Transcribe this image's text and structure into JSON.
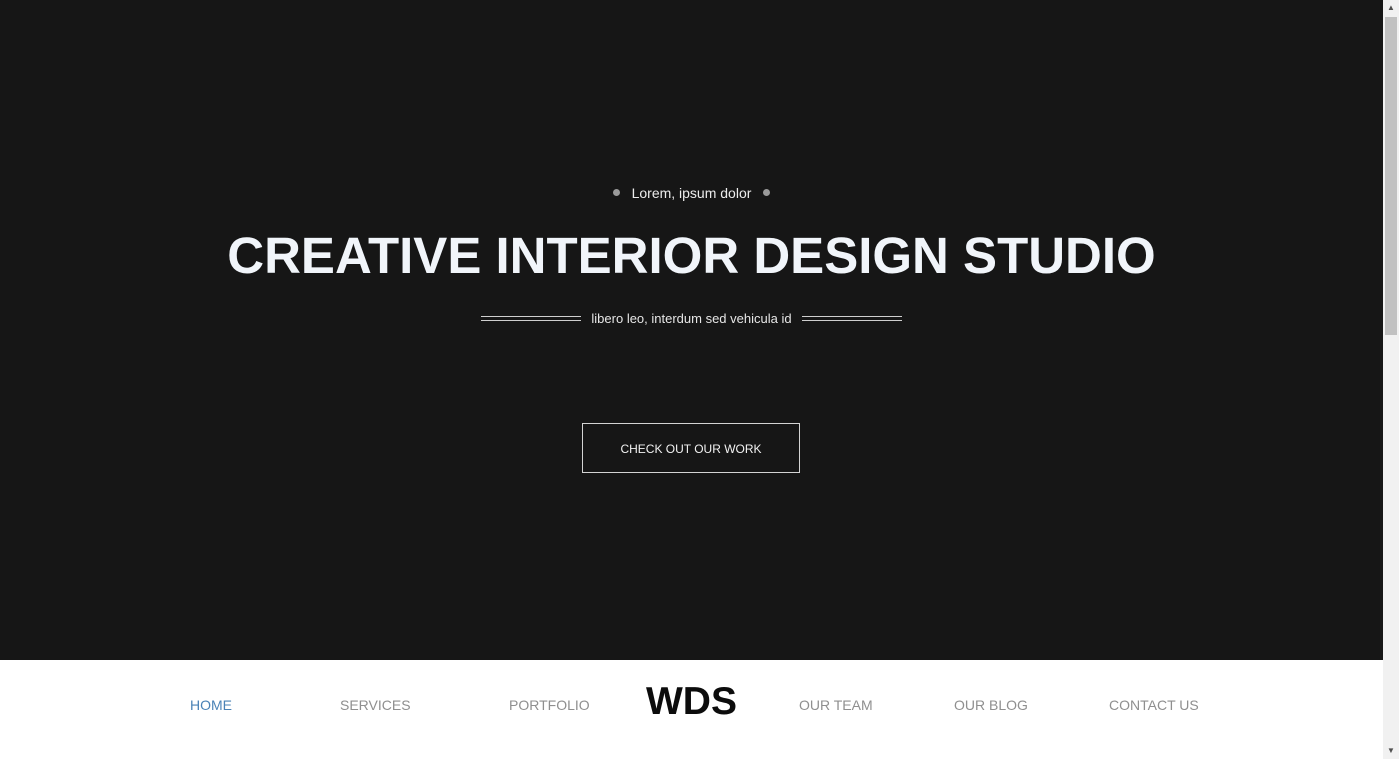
{
  "hero": {
    "eyebrow": "Lorem, ipsum dolor",
    "headline": "CREATIVE INTERIOR DESIGN STUDIO",
    "tagline": "libero leo, interdum sed vehicula id",
    "cta_label": "CHECK OUT OUR WORK",
    "background_color": "#161616"
  },
  "nav": {
    "items": [
      {
        "label": "HOME",
        "active": true
      },
      {
        "label": "SERVICES",
        "active": false
      },
      {
        "label": "PORTFOLIO",
        "active": false
      },
      {
        "label": "OUR TEAM",
        "active": false
      },
      {
        "label": "OUR BLOG",
        "active": false
      },
      {
        "label": "CONTACT US",
        "active": false
      }
    ],
    "logo": "WDS",
    "active_color": "#4a82b6",
    "link_color": "#8f8f8f"
  },
  "scrollbar": {
    "up_icon": "chevron-up-icon",
    "down_icon": "chevron-down-icon"
  }
}
